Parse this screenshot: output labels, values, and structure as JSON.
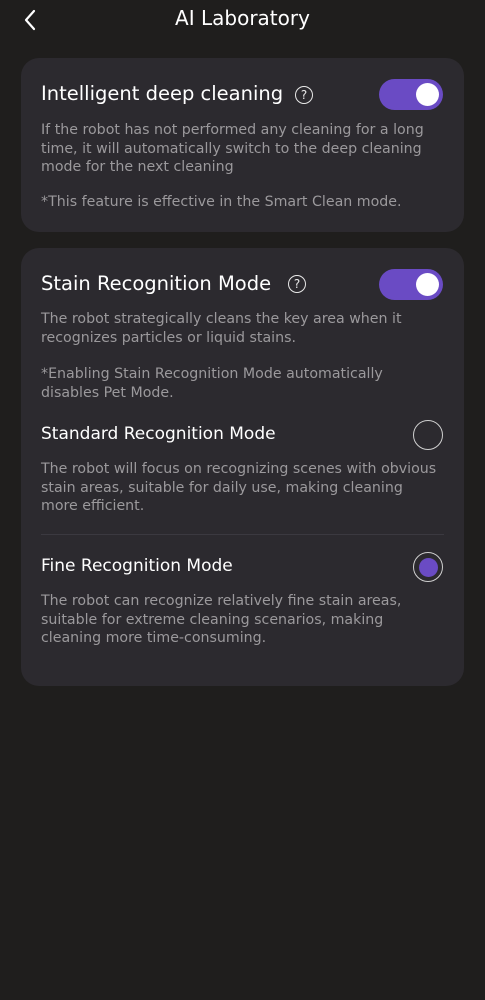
{
  "header": {
    "title": "AI Laboratory",
    "back_icon": "chevron-left-icon"
  },
  "deep_cleaning": {
    "title": "Intelligent deep cleaning",
    "help_glyph": "?",
    "enabled": true,
    "description": "If the robot has not performed any cleaning for a long time, it will automatically switch to the deep cleaning mode for the next cleaning",
    "note": "*This feature is effective in the Smart Clean mode."
  },
  "stain_recognition": {
    "title": "Stain Recognition Mode",
    "help_glyph": "?",
    "enabled": true,
    "description": "The robot strategically cleans the key area when it recognizes particles or liquid stains.",
    "note": "*Enabling Stain Recognition Mode automatically disables Pet Mode.",
    "options": [
      {
        "title": "Standard Recognition Mode",
        "description": "The robot will focus on recognizing scenes with obvious stain areas, suitable for daily use, making cleaning more efficient.",
        "selected": false
      },
      {
        "title": "Fine Recognition Mode",
        "description": "The robot can recognize relatively fine stain areas, suitable for extreme cleaning scenarios, making cleaning more time-consuming.",
        "selected": true
      }
    ]
  },
  "colors": {
    "background": "#1f1e1d",
    "card": "#2c2a2f",
    "accent": "#6a4bc4",
    "secondary_text": "#9b999c"
  }
}
